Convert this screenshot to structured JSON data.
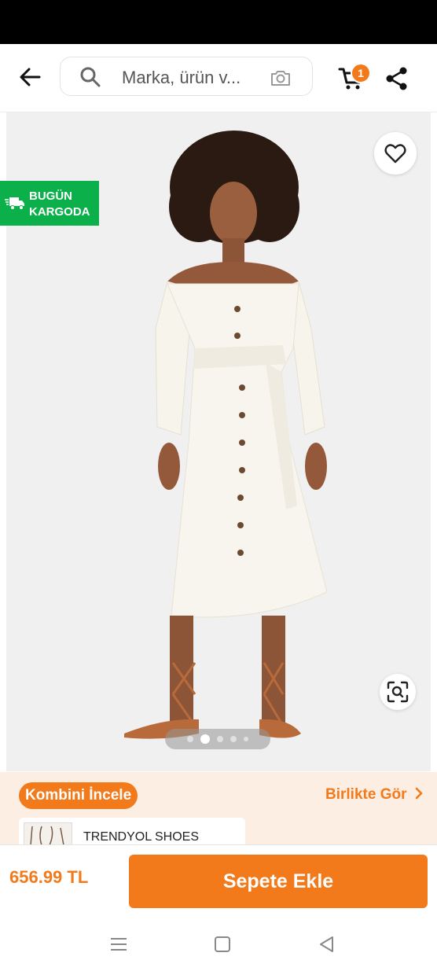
{
  "header": {
    "search_placeholder": "Marka, ürün v...",
    "cart_count": "1"
  },
  "badges": {
    "cargo_line1": "BUGÜN",
    "cargo_line2": "KARGODA"
  },
  "gallery": {
    "total_images": 5,
    "active_index": 1
  },
  "combine": {
    "label": "Kombini İncele",
    "see_together": "Birlikte Gör",
    "item_brand": "TRENDYOL SHOES"
  },
  "footer": {
    "price": "656.99 TL",
    "add_to_cart": "Sepete Ekle"
  },
  "colors": {
    "brand_orange": "#f27a1a",
    "cargo_green": "#0bb04b"
  }
}
